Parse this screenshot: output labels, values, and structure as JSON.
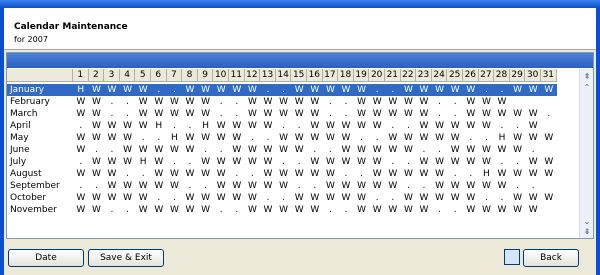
{
  "header": {
    "title": "Calendar Maintenance",
    "subtitle": "for 2007"
  },
  "grid": {
    "columns": [
      "1",
      "2",
      "3",
      "4",
      "5",
      "6",
      "7",
      "8",
      "9",
      "10",
      "11",
      "12",
      "13",
      "14",
      "15",
      "16",
      "17",
      "18",
      "19",
      "20",
      "21",
      "22",
      "23",
      "24",
      "25",
      "26",
      "27",
      "28",
      "29",
      "30",
      "31"
    ],
    "rows": [
      {
        "month": "January",
        "selected": true,
        "days": "H W W W W . . W W W W W . . W W W W W . . W W W W W . . W W W"
      },
      {
        "month": "February",
        "selected": false,
        "days": "W W . . W W W W W . . W W W W W . . W W W W W . . W W W"
      },
      {
        "month": "March",
        "selected": false,
        "days": "W W . . W W W W W . . W W W W W . . W W W W W . . W W W W W ."
      },
      {
        "month": "April",
        "selected": false,
        "days": ". W W W W H . . H W W W W . . W W W W W . . W W W W W . . W"
      },
      {
        "month": "May",
        "selected": false,
        "days": "W W W W . . H W W W W . . W W W W W . . W W W W W . . H W W W"
      },
      {
        "month": "June",
        "selected": false,
        "days": "W . . W W W W W . . W W W W W . . W W W W W . . W W W W W ."
      },
      {
        "month": "July",
        "selected": false,
        "days": ". W W W H W . . W W W W W . . W W W W W . . W W W W W . . W W"
      },
      {
        "month": "August",
        "selected": false,
        "days": "W W W . . W W W W W . . W W W W W . . W W W W W . . H W W W W"
      },
      {
        "month": "September",
        "selected": false,
        "days": ". . W W W W W . . W W W W W . . W W W W W . . W W W W W . ."
      },
      {
        "month": "October",
        "selected": false,
        "days": "W W W W W . . W W W W W . . W W W W W . . W W W W W . . W W W"
      },
      {
        "month": "November",
        "selected": false,
        "days": "W W . . W W W W W . . W W W W W . . W W W W W . . W W W W W"
      }
    ]
  },
  "footer": {
    "date_label": "Date",
    "save_exit_label": "Save & Exit",
    "back_label": "Back"
  }
}
